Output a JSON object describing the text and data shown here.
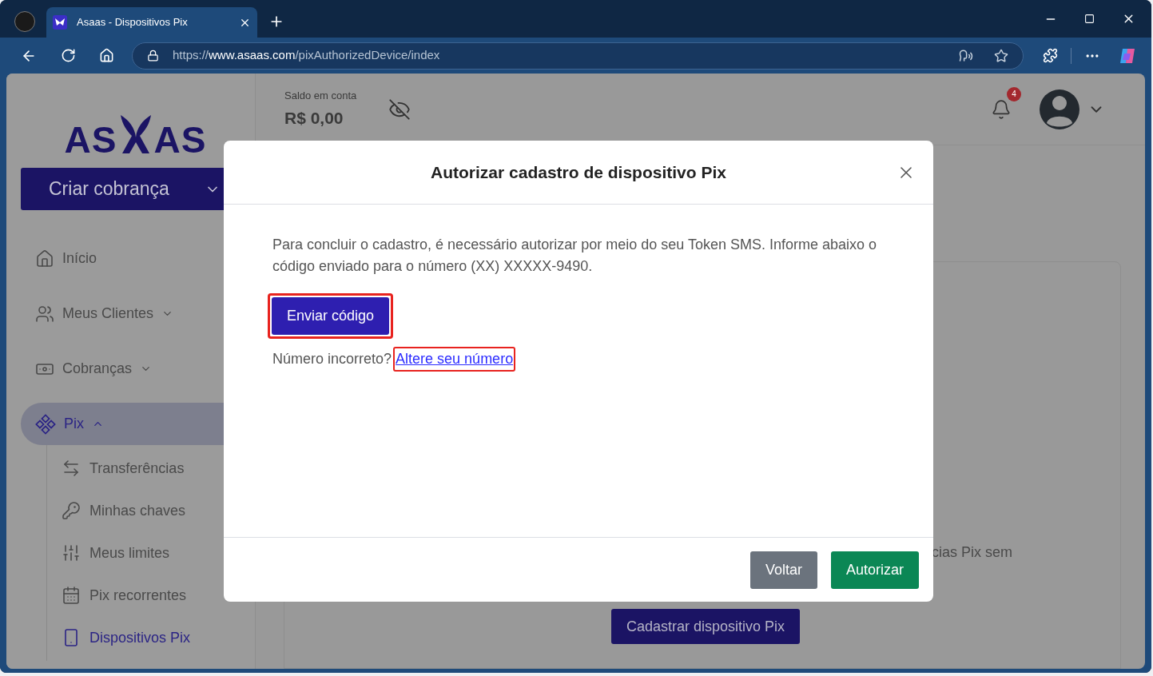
{
  "browser": {
    "tabs": [
      {
        "title": "Asaas - Dispositivos Pix",
        "selected": true
      }
    ],
    "url": {
      "scheme": "https://",
      "host": "www.asaas.com",
      "path": "/pixAuthorizedDevice/index"
    }
  },
  "sidebar": {
    "logo": {
      "left": "AS",
      "right": "AS"
    },
    "create_button": "Criar cobrança",
    "items": [
      {
        "label": "Início",
        "selected": false
      },
      {
        "label": "Meus Clientes",
        "selected": false,
        "expanded": false
      },
      {
        "label": "Cobranças",
        "selected": false,
        "expanded": false
      },
      {
        "label": "Pix",
        "selected": true,
        "expanded": true,
        "children": [
          {
            "label": "Transferências",
            "selected": false
          },
          {
            "label": "Minhas chaves",
            "selected": false
          },
          {
            "label": "Meus limites",
            "selected": false
          },
          {
            "label": "Pix recorrentes",
            "selected": false
          },
          {
            "label": "Dispositivos Pix",
            "selected": true
          }
        ]
      }
    ]
  },
  "header": {
    "balance_label": "Saldo em conta",
    "balance": "R$ 0,00",
    "notifications": "4"
  },
  "main": {
    "text_fragment": "cias Pix sem",
    "register_button": "Cadastrar dispositivo Pix"
  },
  "modal": {
    "title": "Autorizar cadastro de dispositivo Pix",
    "message": "Para concluir o cadastro, é necessário autorizar por meio do seu Token SMS. Informe abaixo o código enviado para o número (XX) XXXXX-9490.",
    "send_button": {
      "label": "Enviar código",
      "highlighted": true
    },
    "prompt": "Número incorreto?",
    "link": {
      "label": "Altere seu número",
      "highlighted": true
    },
    "buttons": [
      {
        "label": "Voltar",
        "kind": "secondary"
      },
      {
        "label": "Autorizar",
        "kind": "primary"
      }
    ]
  }
}
